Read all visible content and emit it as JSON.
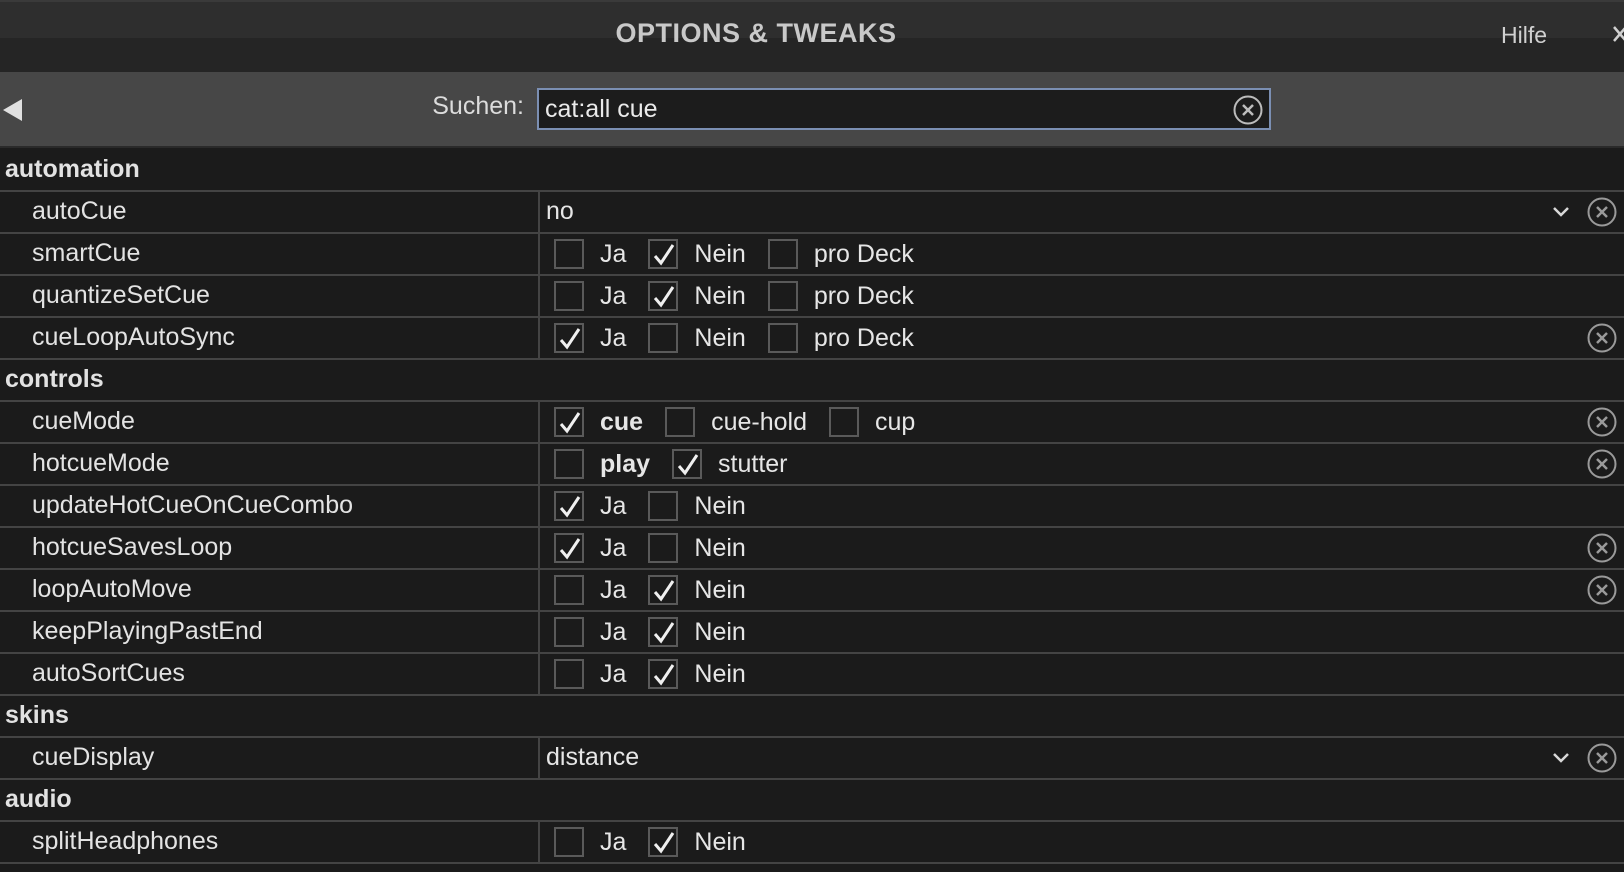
{
  "header": {
    "title": "OPTIONS & TWEAKS",
    "help_label": "Hilfe"
  },
  "search": {
    "label": "Suchen:",
    "value": "cat:all cue"
  },
  "colors": {
    "background": "#1b1b1b",
    "searchbar": "#474747",
    "input_border": "#7b8fb3"
  },
  "categories": [
    {
      "name": "automation",
      "options": [
        {
          "name": "autoCue",
          "type": "select",
          "value": "no",
          "reset": true
        },
        {
          "name": "smartCue",
          "type": "choices",
          "reset": false,
          "choices": [
            {
              "label": "Ja",
              "checked": false,
              "bold": false
            },
            {
              "label": "Nein",
              "checked": true,
              "bold": false
            },
            {
              "label": "pro Deck",
              "checked": false,
              "bold": false
            }
          ]
        },
        {
          "name": "quantizeSetCue",
          "type": "choices",
          "reset": false,
          "choices": [
            {
              "label": "Ja",
              "checked": false,
              "bold": false
            },
            {
              "label": "Nein",
              "checked": true,
              "bold": false
            },
            {
              "label": "pro Deck",
              "checked": false,
              "bold": false
            }
          ]
        },
        {
          "name": "cueLoopAutoSync",
          "type": "choices",
          "reset": true,
          "choices": [
            {
              "label": "Ja",
              "checked": true,
              "bold": false
            },
            {
              "label": "Nein",
              "checked": false,
              "bold": false
            },
            {
              "label": "pro Deck",
              "checked": false,
              "bold": false
            }
          ]
        }
      ]
    },
    {
      "name": "controls",
      "options": [
        {
          "name": "cueMode",
          "type": "choices",
          "reset": true,
          "choices": [
            {
              "label": "cue",
              "checked": true,
              "bold": true
            },
            {
              "label": "cue-hold",
              "checked": false,
              "bold": false
            },
            {
              "label": "cup",
              "checked": false,
              "bold": false
            }
          ]
        },
        {
          "name": "hotcueMode",
          "type": "choices",
          "reset": true,
          "choices": [
            {
              "label": "play",
              "checked": false,
              "bold": true
            },
            {
              "label": "stutter",
              "checked": true,
              "bold": false
            }
          ]
        },
        {
          "name": "updateHotCueOnCueCombo",
          "type": "choices",
          "reset": false,
          "choices": [
            {
              "label": "Ja",
              "checked": true,
              "bold": false
            },
            {
              "label": "Nein",
              "checked": false,
              "bold": false
            }
          ]
        },
        {
          "name": "hotcueSavesLoop",
          "type": "choices",
          "reset": true,
          "choices": [
            {
              "label": "Ja",
              "checked": true,
              "bold": false
            },
            {
              "label": "Nein",
              "checked": false,
              "bold": false
            }
          ]
        },
        {
          "name": "loopAutoMove",
          "type": "choices",
          "reset": true,
          "choices": [
            {
              "label": "Ja",
              "checked": false,
              "bold": false
            },
            {
              "label": "Nein",
              "checked": true,
              "bold": false
            }
          ]
        },
        {
          "name": "keepPlayingPastEnd",
          "type": "choices",
          "reset": false,
          "choices": [
            {
              "label": "Ja",
              "checked": false,
              "bold": false
            },
            {
              "label": "Nein",
              "checked": true,
              "bold": false
            }
          ]
        },
        {
          "name": "autoSortCues",
          "type": "choices",
          "reset": false,
          "choices": [
            {
              "label": "Ja",
              "checked": false,
              "bold": false
            },
            {
              "label": "Nein",
              "checked": true,
              "bold": false
            }
          ]
        }
      ]
    },
    {
      "name": "skins",
      "options": [
        {
          "name": "cueDisplay",
          "type": "select",
          "value": "distance",
          "reset": true
        }
      ]
    },
    {
      "name": "audio",
      "options": [
        {
          "name": "splitHeadphones",
          "type": "choices",
          "reset": false,
          "choices": [
            {
              "label": "Ja",
              "checked": false,
              "bold": false
            },
            {
              "label": "Nein",
              "checked": true,
              "bold": false
            }
          ]
        }
      ]
    }
  ]
}
